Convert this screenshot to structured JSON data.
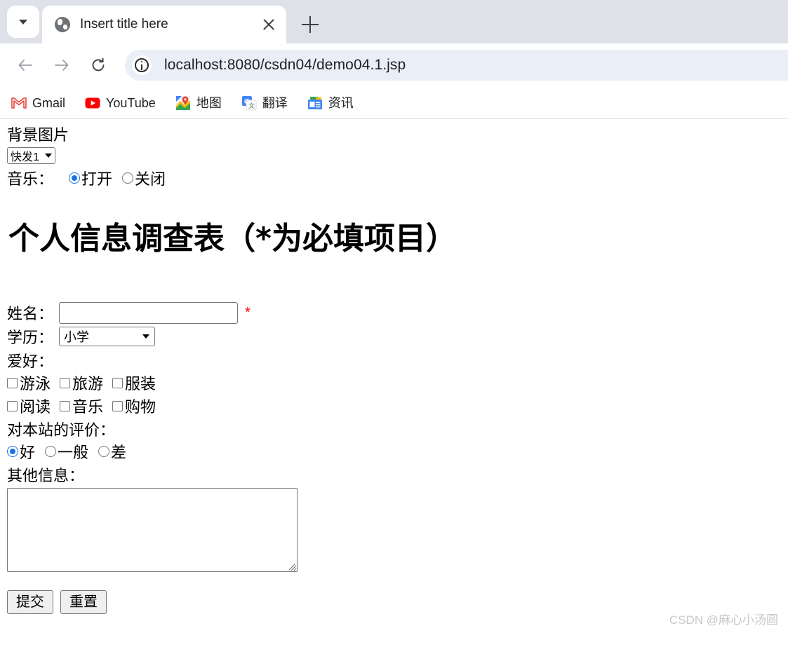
{
  "browser": {
    "tab": {
      "title": "Insert title here",
      "favicon": "globe-icon",
      "close_label": "",
      "newtab_label": ""
    },
    "tab_list_button": "tab-search-chevron",
    "nav": {
      "back": "back-arrow",
      "forward": "forward-arrow",
      "reload": "reload-icon"
    },
    "omnibox": {
      "site_info_icon": "info-circle-icon",
      "url": "localhost:8080/csdn04/demo04.1.jsp"
    },
    "bookmarks": [
      {
        "label": "Gmail",
        "icon": "gmail-icon"
      },
      {
        "label": "YouTube",
        "icon": "youtube-icon"
      },
      {
        "label": "地图",
        "icon": "google-maps-icon"
      },
      {
        "label": "翻译",
        "icon": "google-translate-icon"
      },
      {
        "label": "资讯",
        "icon": "google-news-icon"
      }
    ]
  },
  "page": {
    "background_label": "背景图片",
    "background_select": {
      "value": "快发1",
      "options": [
        "快发1"
      ]
    },
    "music": {
      "label": "音乐：",
      "options": [
        {
          "label": "打开",
          "selected": true
        },
        {
          "label": "关闭",
          "selected": false
        }
      ]
    },
    "headline": "个人信息调查表（*为必填项目）",
    "form": {
      "name": {
        "label": "姓名：",
        "value": "",
        "required_mark": "*"
      },
      "education": {
        "label": "学历：",
        "value": "小学",
        "options": [
          "小学"
        ]
      },
      "hobby": {
        "label": "爱好：",
        "items": [
          {
            "label": "游泳",
            "checked": false
          },
          {
            "label": "旅游",
            "checked": false
          },
          {
            "label": "服装",
            "checked": false
          },
          {
            "label": "阅读",
            "checked": false
          },
          {
            "label": "音乐",
            "checked": false
          },
          {
            "label": "购物",
            "checked": false
          }
        ]
      },
      "rating": {
        "label": "对本站的评价：",
        "options": [
          {
            "label": "好",
            "selected": true
          },
          {
            "label": "一般",
            "selected": false
          },
          {
            "label": "差",
            "selected": false
          }
        ]
      },
      "other": {
        "label": "其他信息：",
        "value": ""
      },
      "submit_label": "提交",
      "reset_label": "重置"
    },
    "watermark": "CSDN @麻心小汤圆"
  },
  "colors": {
    "tabstrip": "#dee2e8",
    "omnibox": "#eaeef7",
    "accent_blue": "#1a73e8",
    "required_red": "#ff0000",
    "watermark_gray": "#c8c8c8"
  }
}
